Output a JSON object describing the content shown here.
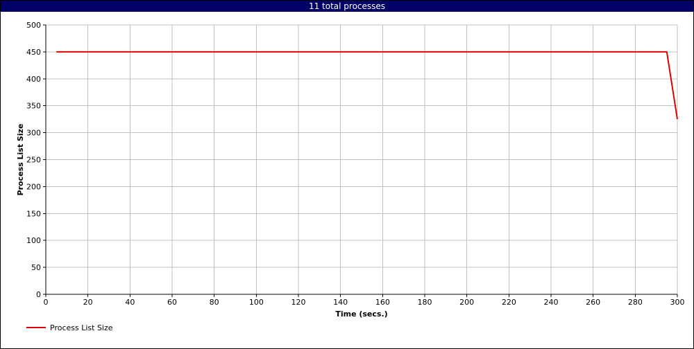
{
  "window": {
    "title": "11 total processes"
  },
  "colors": {
    "title_bar": "#000066",
    "series": "#dd0000",
    "grid": "#c0c0c0",
    "axis": "#000000"
  },
  "chart_data": {
    "type": "line",
    "title": "11 total processes",
    "xlabel": "Time (secs.)",
    "ylabel": "Process List Size",
    "xlim": [
      0,
      300
    ],
    "ylim": [
      0,
      500
    ],
    "x_ticks": [
      0,
      20,
      40,
      60,
      80,
      100,
      120,
      140,
      160,
      180,
      200,
      220,
      240,
      260,
      280,
      300
    ],
    "y_ticks": [
      0,
      50,
      100,
      150,
      200,
      250,
      300,
      350,
      400,
      450,
      500
    ],
    "grid": true,
    "legend_position": "bottom-left",
    "series": [
      {
        "name": "Process List Size",
        "color": "#dd0000",
        "x": [
          5,
          295,
          300
        ],
        "y": [
          450,
          450,
          325
        ]
      }
    ]
  }
}
